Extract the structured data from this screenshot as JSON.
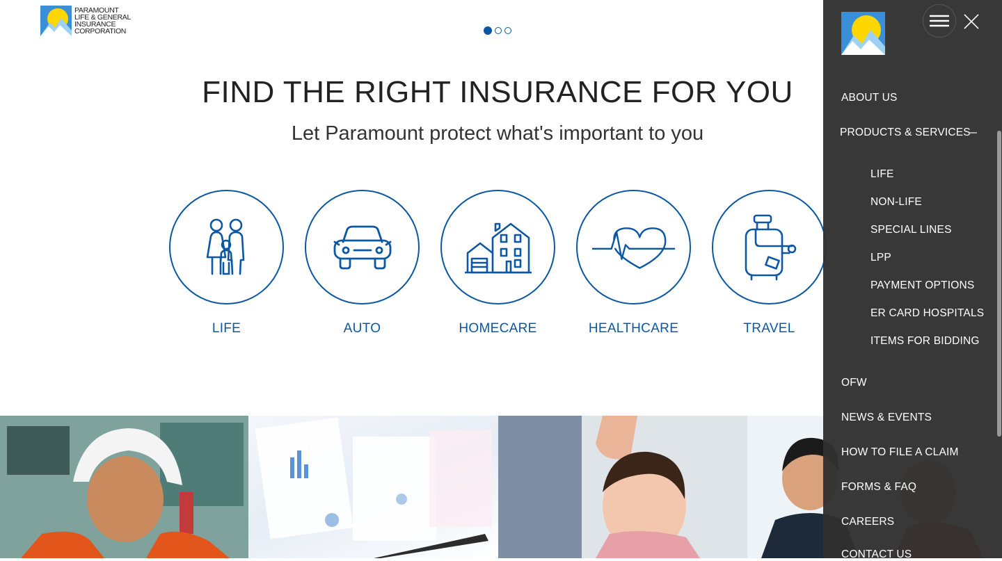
{
  "brand": {
    "logo_lines": [
      "PARAMOUNT",
      "LIFE & GENERAL",
      "INSURANCE",
      "CORPORATION"
    ],
    "colors": {
      "primary": "#0b57a4",
      "sun": "#ffd700",
      "sky": "#3a8fd6"
    }
  },
  "carousel": {
    "slides": 3,
    "active": 1
  },
  "hero": {
    "title": "FIND THE RIGHT INSURANCE FOR YOU",
    "subtitle": "Let Paramount protect what's important to you"
  },
  "products": [
    {
      "label": "LIFE",
      "icon": "family-icon"
    },
    {
      "label": "AUTO",
      "icon": "car-icon"
    },
    {
      "label": "HOMECARE",
      "icon": "house-icon"
    },
    {
      "label": "HEALTHCARE",
      "icon": "heartbeat-icon"
    },
    {
      "label": "TRAVEL",
      "icon": "luggage-icon"
    }
  ],
  "menu": {
    "items": [
      {
        "label": "ABOUT US"
      },
      {
        "label": "PRODUCTS & SERVICES",
        "expanded": true,
        "children": [
          "LIFE",
          "NON-LIFE",
          "SPECIAL LINES",
          "LPP",
          "PAYMENT OPTIONS",
          "ER CARD HOSPITALS",
          "ITEMS FOR BIDDING"
        ]
      },
      {
        "label": "OFW"
      },
      {
        "label": "NEWS & EVENTS"
      },
      {
        "label": "HOW TO FILE A CLAIM"
      },
      {
        "label": "FORMS & FAQ"
      },
      {
        "label": "CAREERS"
      },
      {
        "label": "CONTACT US"
      }
    ]
  }
}
